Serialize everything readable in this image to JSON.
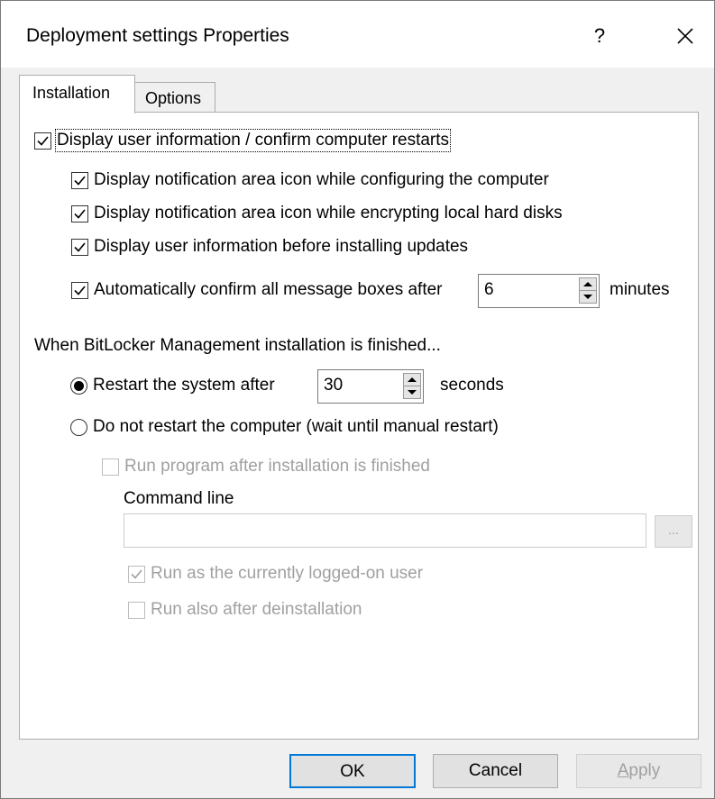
{
  "window": {
    "title": "Deployment settings Properties",
    "help_label": "?",
    "close_label": "close"
  },
  "tabs": [
    {
      "label": "Installation",
      "active": true
    },
    {
      "label": "Options",
      "active": false
    }
  ],
  "checkboxes": {
    "display_user_info": {
      "label": "Display user information / confirm computer restarts",
      "checked": true
    },
    "notify_config": {
      "label": "Display notification area icon while configuring the computer",
      "checked": true
    },
    "notify_encrypt": {
      "label": "Display notification area icon while encrypting local hard disks",
      "checked": true
    },
    "user_info_updates": {
      "label": "Display user information before installing updates",
      "checked": true
    },
    "auto_confirm": {
      "label": "Automatically confirm all message boxes after",
      "checked": true,
      "value": "6",
      "unit": "minutes"
    }
  },
  "finish_section": {
    "heading": "When BitLocker Management installation is finished...",
    "restart_after": {
      "label": "Restart the system after",
      "selected": true,
      "value": "30",
      "unit": "seconds"
    },
    "no_restart": {
      "label": "Do not restart the computer (wait until manual restart)",
      "selected": false
    },
    "run_program": {
      "label": "Run program after installation is finished",
      "checked": false,
      "enabled": false
    },
    "command_line": {
      "label": "Command line",
      "value": "",
      "browse_label": "..."
    },
    "run_as_user": {
      "label": "Run as the currently logged-on user",
      "checked": true,
      "enabled": false
    },
    "run_after_uninstall": {
      "label": "Run also after deinstallation",
      "checked": false,
      "enabled": false
    }
  },
  "buttons": {
    "ok": "OK",
    "cancel": "Cancel",
    "apply_first": "A",
    "apply_rest": "pply"
  },
  "colors": {
    "focus_border": "#0078d7",
    "disabled_text": "#a0a0a0"
  }
}
